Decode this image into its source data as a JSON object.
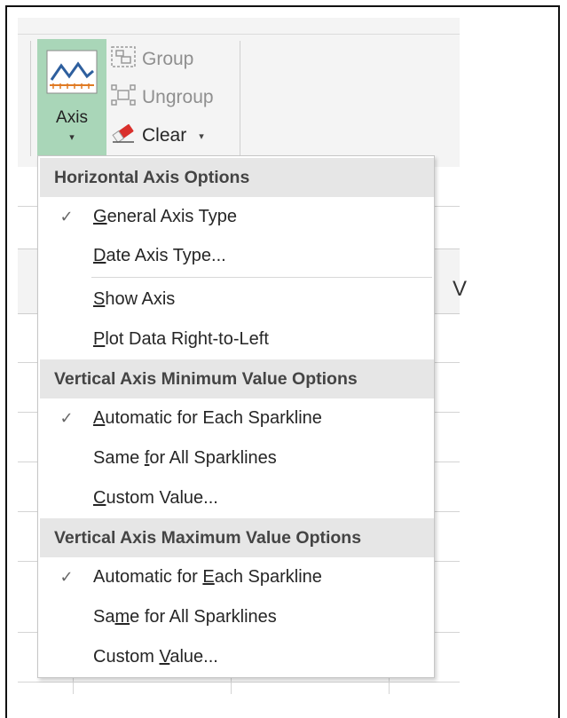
{
  "ribbon": {
    "axis_button": {
      "label": "Axis",
      "icon": "sparkline-axis-icon",
      "caret": "▾"
    },
    "group_button": {
      "label": "Group",
      "icon": "group-icon",
      "state": "disabled"
    },
    "ungroup_button": {
      "label": "Ungroup",
      "icon": "ungroup-icon",
      "state": "disabled"
    },
    "clear_button": {
      "label": "Clear",
      "icon": "eraser-icon",
      "caret": "▾"
    }
  },
  "sheet": {
    "partial_column_header": "V"
  },
  "menu": {
    "horizontal_header": "Horizontal Axis Options",
    "general_axis_type": {
      "pre": "",
      "u": "G",
      "post": "eneral Axis Type",
      "checked": true
    },
    "date_axis_type": {
      "pre": "",
      "u": "D",
      "post": "ate Axis Type...",
      "checked": false
    },
    "show_axis": {
      "pre": "",
      "u": "S",
      "post": "how Axis",
      "checked": false
    },
    "plot_rtl": {
      "pre": "",
      "u": "P",
      "post": "lot Data Right-to-Left",
      "checked": false
    },
    "vmin_header": "Vertical Axis Minimum Value Options",
    "vmin_auto": {
      "pre": "",
      "u": "A",
      "post": "utomatic for Each Sparkline",
      "checked": true
    },
    "vmin_same": {
      "pre": "Same ",
      "u": "f",
      "post": "or All Sparklines",
      "checked": false
    },
    "vmin_custom": {
      "pre": "",
      "u": "C",
      "post": "ustom Value...",
      "checked": false
    },
    "vmax_header": "Vertical Axis Maximum Value Options",
    "vmax_auto": {
      "pre": "Automatic for ",
      "u": "E",
      "post": "ach Sparkline",
      "checked": true
    },
    "vmax_same": {
      "pre": "Sa",
      "u": "m",
      "post": "e for All Sparklines",
      "checked": false
    },
    "vmax_custom": {
      "pre": "Custom ",
      "u": "V",
      "post": "alue...",
      "checked": false
    },
    "check_glyph": "✓"
  },
  "colors": {
    "accent_selected": "#a9d6b8",
    "header_bg": "#e6e6e6",
    "disabled_text": "#8f8f8f"
  }
}
